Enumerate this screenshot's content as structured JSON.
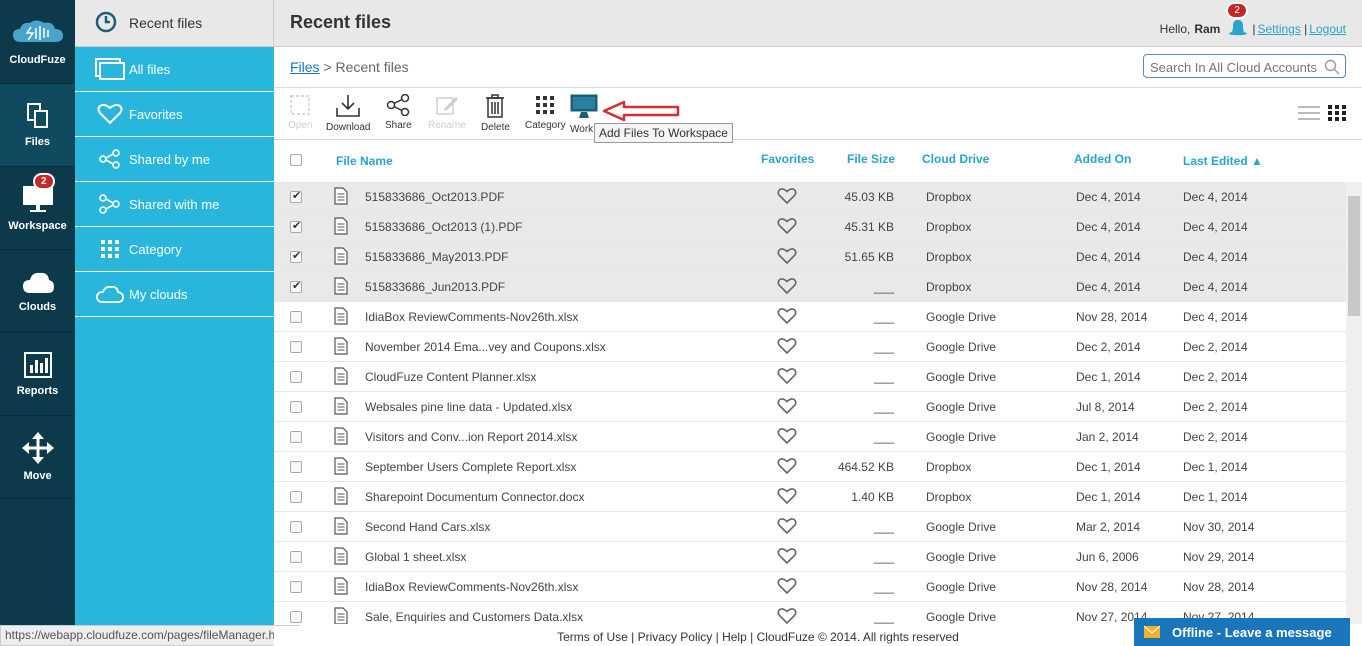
{
  "brand": {
    "name": "CloudFuze"
  },
  "rail": {
    "items": [
      {
        "label": "Files",
        "icon": "files-icon"
      },
      {
        "label": "Workspace",
        "icon": "workspace-icon",
        "badge": "2"
      },
      {
        "label": "Clouds",
        "icon": "cloud-icon"
      },
      {
        "label": "Reports",
        "icon": "reports-icon"
      },
      {
        "label": "Move",
        "icon": "move-icon"
      }
    ]
  },
  "sidebar": {
    "header": "Recent files",
    "items": [
      {
        "label": "All files",
        "icon": "all-files-icon"
      },
      {
        "label": "Favorites",
        "icon": "heart-icon"
      },
      {
        "label": "Shared by me",
        "icon": "share-icon"
      },
      {
        "label": "Shared with me",
        "icon": "shared-with-icon"
      },
      {
        "label": "Category",
        "icon": "grid-icon"
      },
      {
        "label": "My clouds",
        "icon": "cloud-outline-icon"
      }
    ]
  },
  "header": {
    "title": "Recent files",
    "greeting": "Hello,",
    "username": "Ram",
    "notifications": "2",
    "settings": "Settings",
    "logout": "Logout"
  },
  "breadcrumb": {
    "root": "Files",
    "sep": ">",
    "current": "Recent files"
  },
  "search": {
    "placeholder": "Search In All Cloud Accounts"
  },
  "toolbar": {
    "open": "Open",
    "download": "Download",
    "share": "Share",
    "rename": "Rename",
    "delete": "Delete",
    "category": "Category",
    "workspace": "Work",
    "tooltip": "Add Files To Workspace"
  },
  "table": {
    "headers": {
      "name": "File Name",
      "favorites": "Favorites",
      "size": "File Size",
      "cloud": "Cloud Drive",
      "added": "Added On",
      "edited": "Last Edited ▲"
    },
    "rows": [
      {
        "name": "515833686_Oct2013.PDF",
        "size": "45.03 KB",
        "cloud": "Dropbox",
        "added": "Dec 4, 2014",
        "edited": "Dec 4, 2014",
        "checked": true
      },
      {
        "name": "515833686_Oct2013 (1).PDF",
        "size": "45.31 KB",
        "cloud": "Dropbox",
        "added": "Dec 4, 2014",
        "edited": "Dec 4, 2014",
        "checked": true
      },
      {
        "name": "515833686_May2013.PDF",
        "size": "51.65 KB",
        "cloud": "Dropbox",
        "added": "Dec 4, 2014",
        "edited": "Dec 4, 2014",
        "checked": true
      },
      {
        "name": "515833686_Jun2013.PDF",
        "size": "___",
        "cloud": "Dropbox",
        "added": "Dec 4, 2014",
        "edited": "Dec 4, 2014",
        "checked": true
      },
      {
        "name": "IdiaBox ReviewComments-Nov26th.xlsx",
        "size": "___",
        "cloud": "Google Drive",
        "added": "Nov 28, 2014",
        "edited": "Dec 4, 2014",
        "checked": false
      },
      {
        "name": "November 2014 Ema...vey and Coupons.xlsx",
        "size": "___",
        "cloud": "Google Drive",
        "added": "Dec 2, 2014",
        "edited": "Dec 2, 2014",
        "checked": false
      },
      {
        "name": "CloudFuze Content Planner.xlsx",
        "size": "___",
        "cloud": "Google Drive",
        "added": "Dec 1, 2014",
        "edited": "Dec 2, 2014",
        "checked": false
      },
      {
        "name": "Websales pine line data - Updated.xlsx",
        "size": "___",
        "cloud": "Google Drive",
        "added": "Jul 8, 2014",
        "edited": "Dec 2, 2014",
        "checked": false
      },
      {
        "name": "Visitors and Conv...ion Report 2014.xlsx",
        "size": "___",
        "cloud": "Google Drive",
        "added": "Jan 2, 2014",
        "edited": "Dec 2, 2014",
        "checked": false
      },
      {
        "name": "September Users Complete Report.xlsx",
        "size": "464.52 KB",
        "cloud": "Dropbox",
        "added": "Dec 1, 2014",
        "edited": "Dec 1, 2014",
        "checked": false
      },
      {
        "name": "Sharepoint Documentum Connector.docx",
        "size": "1.40 KB",
        "cloud": "Dropbox",
        "added": "Dec 1, 2014",
        "edited": "Dec 1, 2014",
        "checked": false
      },
      {
        "name": "Second Hand Cars.xlsx",
        "size": "___",
        "cloud": "Google Drive",
        "added": "Mar 2, 2014",
        "edited": "Nov 30, 2014",
        "checked": false
      },
      {
        "name": "Global 1 sheet.xlsx",
        "size": "___",
        "cloud": "Google Drive",
        "added": "Jun 6, 2006",
        "edited": "Nov 29, 2014",
        "checked": false
      },
      {
        "name": "IdiaBox ReviewComments-Nov26th.xlsx",
        "size": "___",
        "cloud": "Google Drive",
        "added": "Nov 28, 2014",
        "edited": "Nov 28, 2014",
        "checked": false
      },
      {
        "name": "Sale, Enquiries and Customers Data.xlsx",
        "size": "___",
        "cloud": "Google Drive",
        "added": "Nov 27, 2014",
        "edited": "Nov 27, 2014",
        "checked": false
      }
    ]
  },
  "statusbar": {
    "url": "https://webapp.cloudfuze.com/pages/fileManager.html#"
  },
  "footer": {
    "terms": "Terms of Use",
    "privacy": "Privacy Policy",
    "help": "Help",
    "copyright": "CloudFuze © 2014. All rights reserved"
  },
  "chat": {
    "label": "Offline - Leave a message"
  },
  "colors": {
    "rail": "#0c3a4a",
    "sidebar": "#29b6dd",
    "accent": "#29a3cc",
    "badge": "#c62828"
  }
}
